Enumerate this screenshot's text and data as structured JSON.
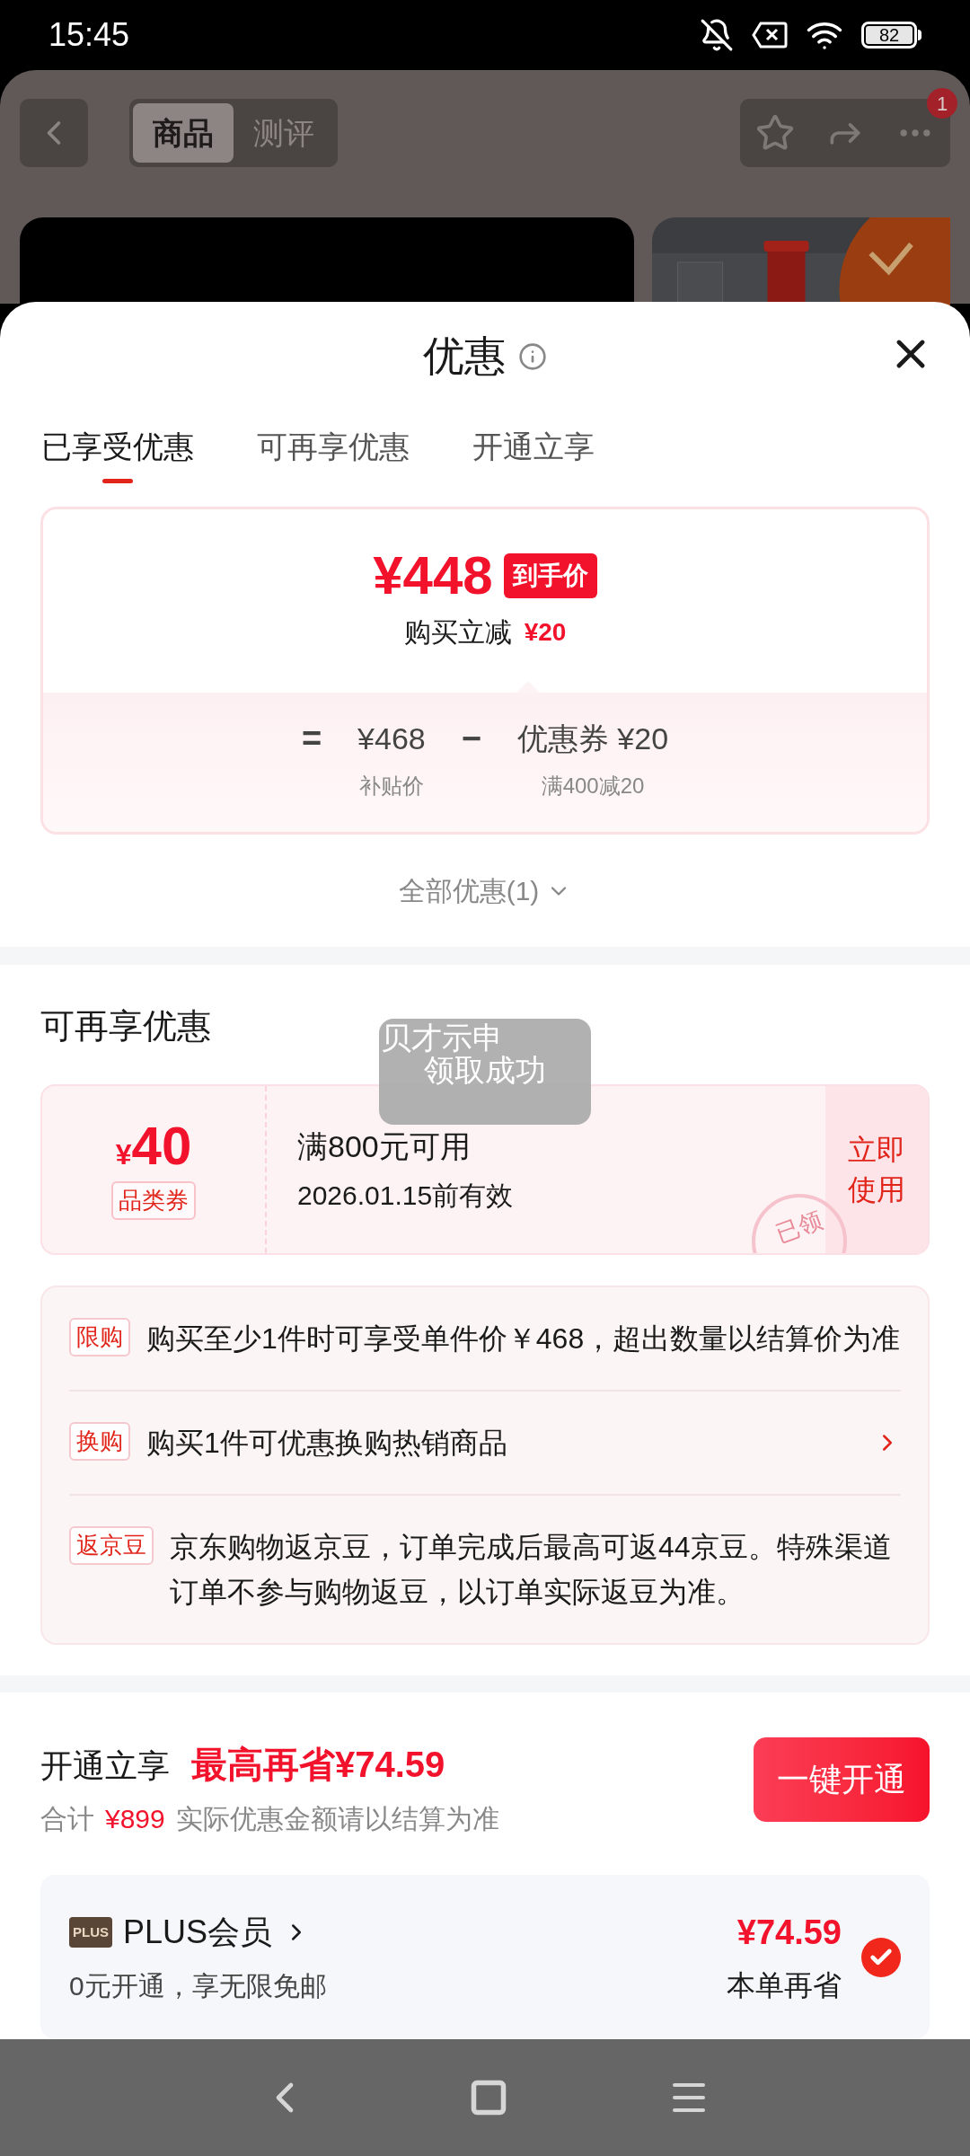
{
  "status_bar": {
    "time": "15:45",
    "battery": "82"
  },
  "background_page": {
    "tabs": [
      {
        "label": "商品",
        "selected": true
      },
      {
        "label": "测评",
        "selected": false
      }
    ],
    "more_badge": "1"
  },
  "sheet": {
    "title": "优惠",
    "tabs": [
      {
        "label": "已享受优惠",
        "selected": true
      },
      {
        "label": "可再享优惠",
        "selected": false
      },
      {
        "label": "开通立享",
        "selected": false
      }
    ],
    "price_summary": {
      "final_price": "¥448",
      "final_price_tag": "到手价",
      "discount_label": "购买立减",
      "discount_amount": "¥20",
      "equation": [
        {
          "kind": "operator",
          "text": "="
        },
        {
          "kind": "term",
          "value": "¥468",
          "caption": "补贴价"
        },
        {
          "kind": "operator",
          "text": "−"
        },
        {
          "kind": "term",
          "value": "优惠券 ¥20",
          "caption": "满400减20"
        }
      ]
    },
    "all_offers_link": "全部优惠(1)",
    "more_offers": {
      "heading": "可再享优惠",
      "coupon": {
        "currency": "¥",
        "amount": "40",
        "type_tag": "品类券",
        "condition": "满800元可用",
        "validity": "2026.01.15前有效",
        "action": "立即使用",
        "stamp": "已领"
      },
      "toast": {
        "lines": [
          "贝才示申",
          "领取成功"
        ]
      },
      "rules": [
        {
          "tag": "限购",
          "text": "购买至少1件时可享受单件价￥468，超出数量以结算价为准",
          "has_arrow": false
        },
        {
          "tag": "换购",
          "text": "购买1件可优惠换购热销商品",
          "has_arrow": true
        },
        {
          "tag": "返京豆",
          "text": "京东购物返京豆，订单完成后最高可返44京豆。特殊渠道订单不参与购物返豆，以订单实际返豆为准。",
          "has_arrow": false
        }
      ]
    },
    "membership": {
      "heading": "开通立享",
      "highlight": "最高再省¥74.59",
      "total_label": "合计",
      "total_amount": "¥899",
      "note": "实际优惠金额请以结算为准",
      "button": "一键开通",
      "plus": {
        "logo": "PLUS",
        "name": "PLUS会员",
        "subtitle": "0元开通，享无限免邮",
        "saving": "¥74.59",
        "saving_label": "本单再省",
        "checked": true
      }
    }
  }
}
